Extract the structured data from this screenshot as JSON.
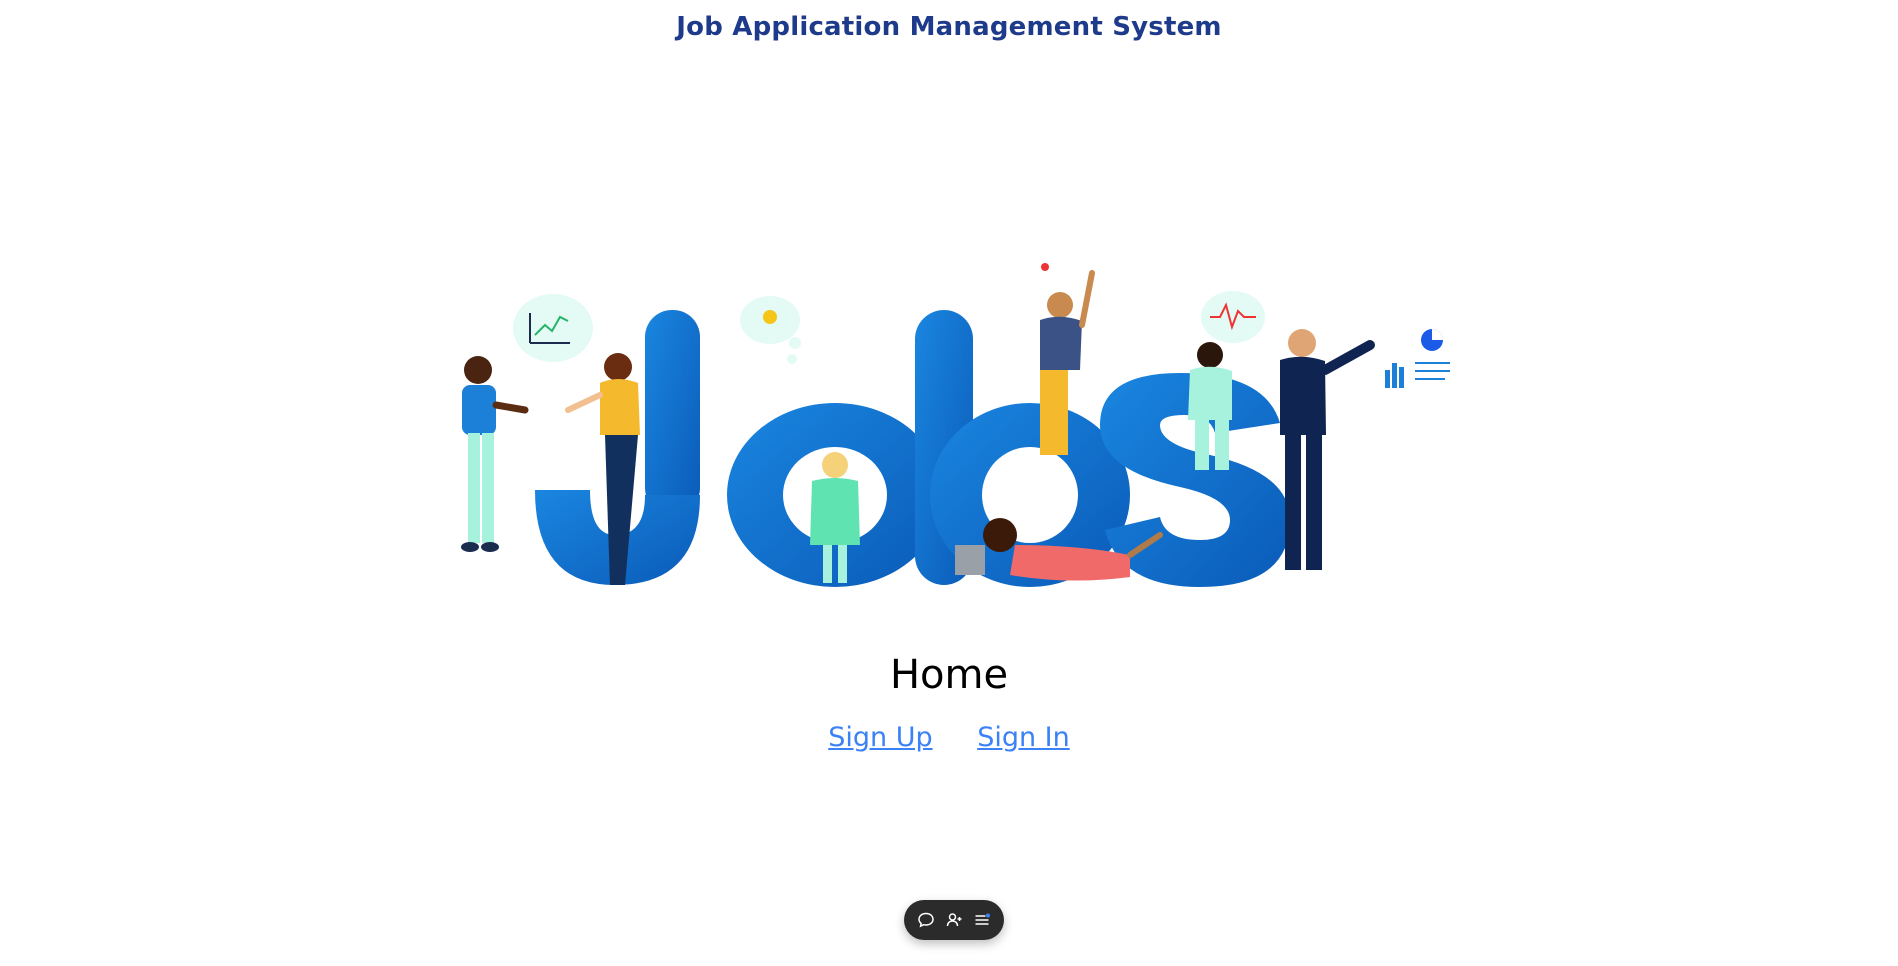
{
  "header": {
    "title": "Job Application Management System"
  },
  "hero": {
    "image_alt": "Jobs"
  },
  "main": {
    "heading": "Home",
    "links": [
      {
        "label": "Sign Up"
      },
      {
        "label": "Sign In"
      }
    ]
  },
  "toolbar": {
    "buttons": [
      {
        "icon": "chat-bubble-icon"
      },
      {
        "icon": "add-user-icon"
      },
      {
        "icon": "menu-list-icon"
      }
    ]
  },
  "colors": {
    "title": "#1e3a8a",
    "link": "#3b82f6",
    "letters": "#0a6fd1",
    "toolbar_bg": "#2b2b2b"
  }
}
